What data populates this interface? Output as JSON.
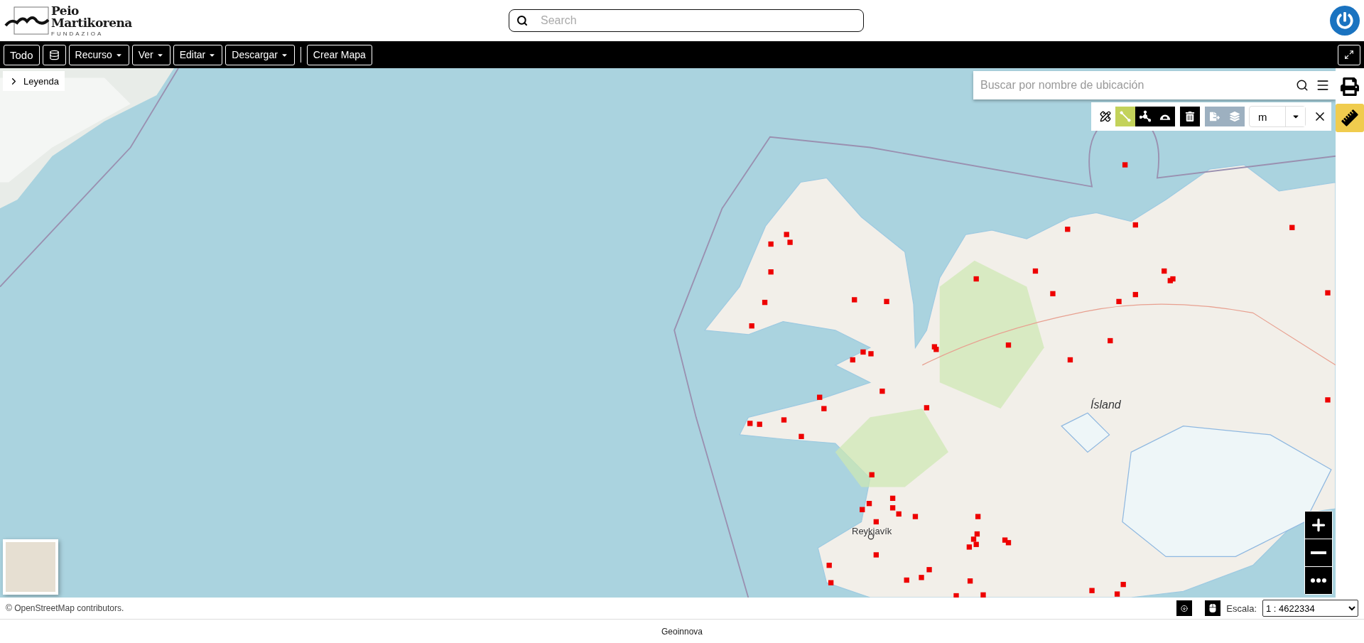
{
  "header": {
    "logo": {
      "line_1": "Peio",
      "line_2": "Martikorena",
      "tagline": "FUNDAZIOA"
    },
    "search": {
      "placeholder": "Search"
    }
  },
  "toolbar": {
    "buttons": [
      {
        "kind": "text",
        "label": "Todo"
      },
      {
        "kind": "layers"
      },
      {
        "kind": "dropdown",
        "label": "Recurso"
      },
      {
        "kind": "dropdown",
        "label": "Ver"
      },
      {
        "kind": "dropdown",
        "label": "Editar"
      },
      {
        "kind": "dropdown",
        "label": "Descargar"
      },
      {
        "kind": "separator"
      },
      {
        "kind": "text",
        "label": "Crear Mapa"
      }
    ]
  },
  "legend": {
    "label": "Leyenda",
    "expanded": false
  },
  "location_search": {
    "placeholder": "Buscar por nombre de ubicación"
  },
  "measure_tools": [
    {
      "kind": "ruler",
      "selected": false,
      "disabled": false
    },
    {
      "kind": "line",
      "selected": true,
      "disabled": false
    },
    {
      "kind": "polygon",
      "selected": false,
      "disabled": false
    },
    {
      "kind": "angle",
      "selected": false,
      "disabled": false
    },
    {
      "kind": "delete",
      "selected": false,
      "disabled": false
    },
    {
      "kind": "export",
      "selected": false,
      "disabled": true
    },
    {
      "kind": "add-layer",
      "selected": false,
      "disabled": true
    }
  ],
  "measure_unit": "m",
  "side_tools": [
    {
      "kind": "print",
      "active": false
    },
    {
      "kind": "measure",
      "active": true
    }
  ],
  "map_labels": [
    {
      "kind": "country",
      "text": "Ísland"
    },
    {
      "kind": "city",
      "text": "Reykjavík"
    }
  ],
  "status_bar": {
    "attribution": "© OpenStreetMap contributors.",
    "scale_label": "Escala:",
    "scale_value": "1 : 4622334"
  },
  "footer": {
    "text": "Geoinnova"
  }
}
